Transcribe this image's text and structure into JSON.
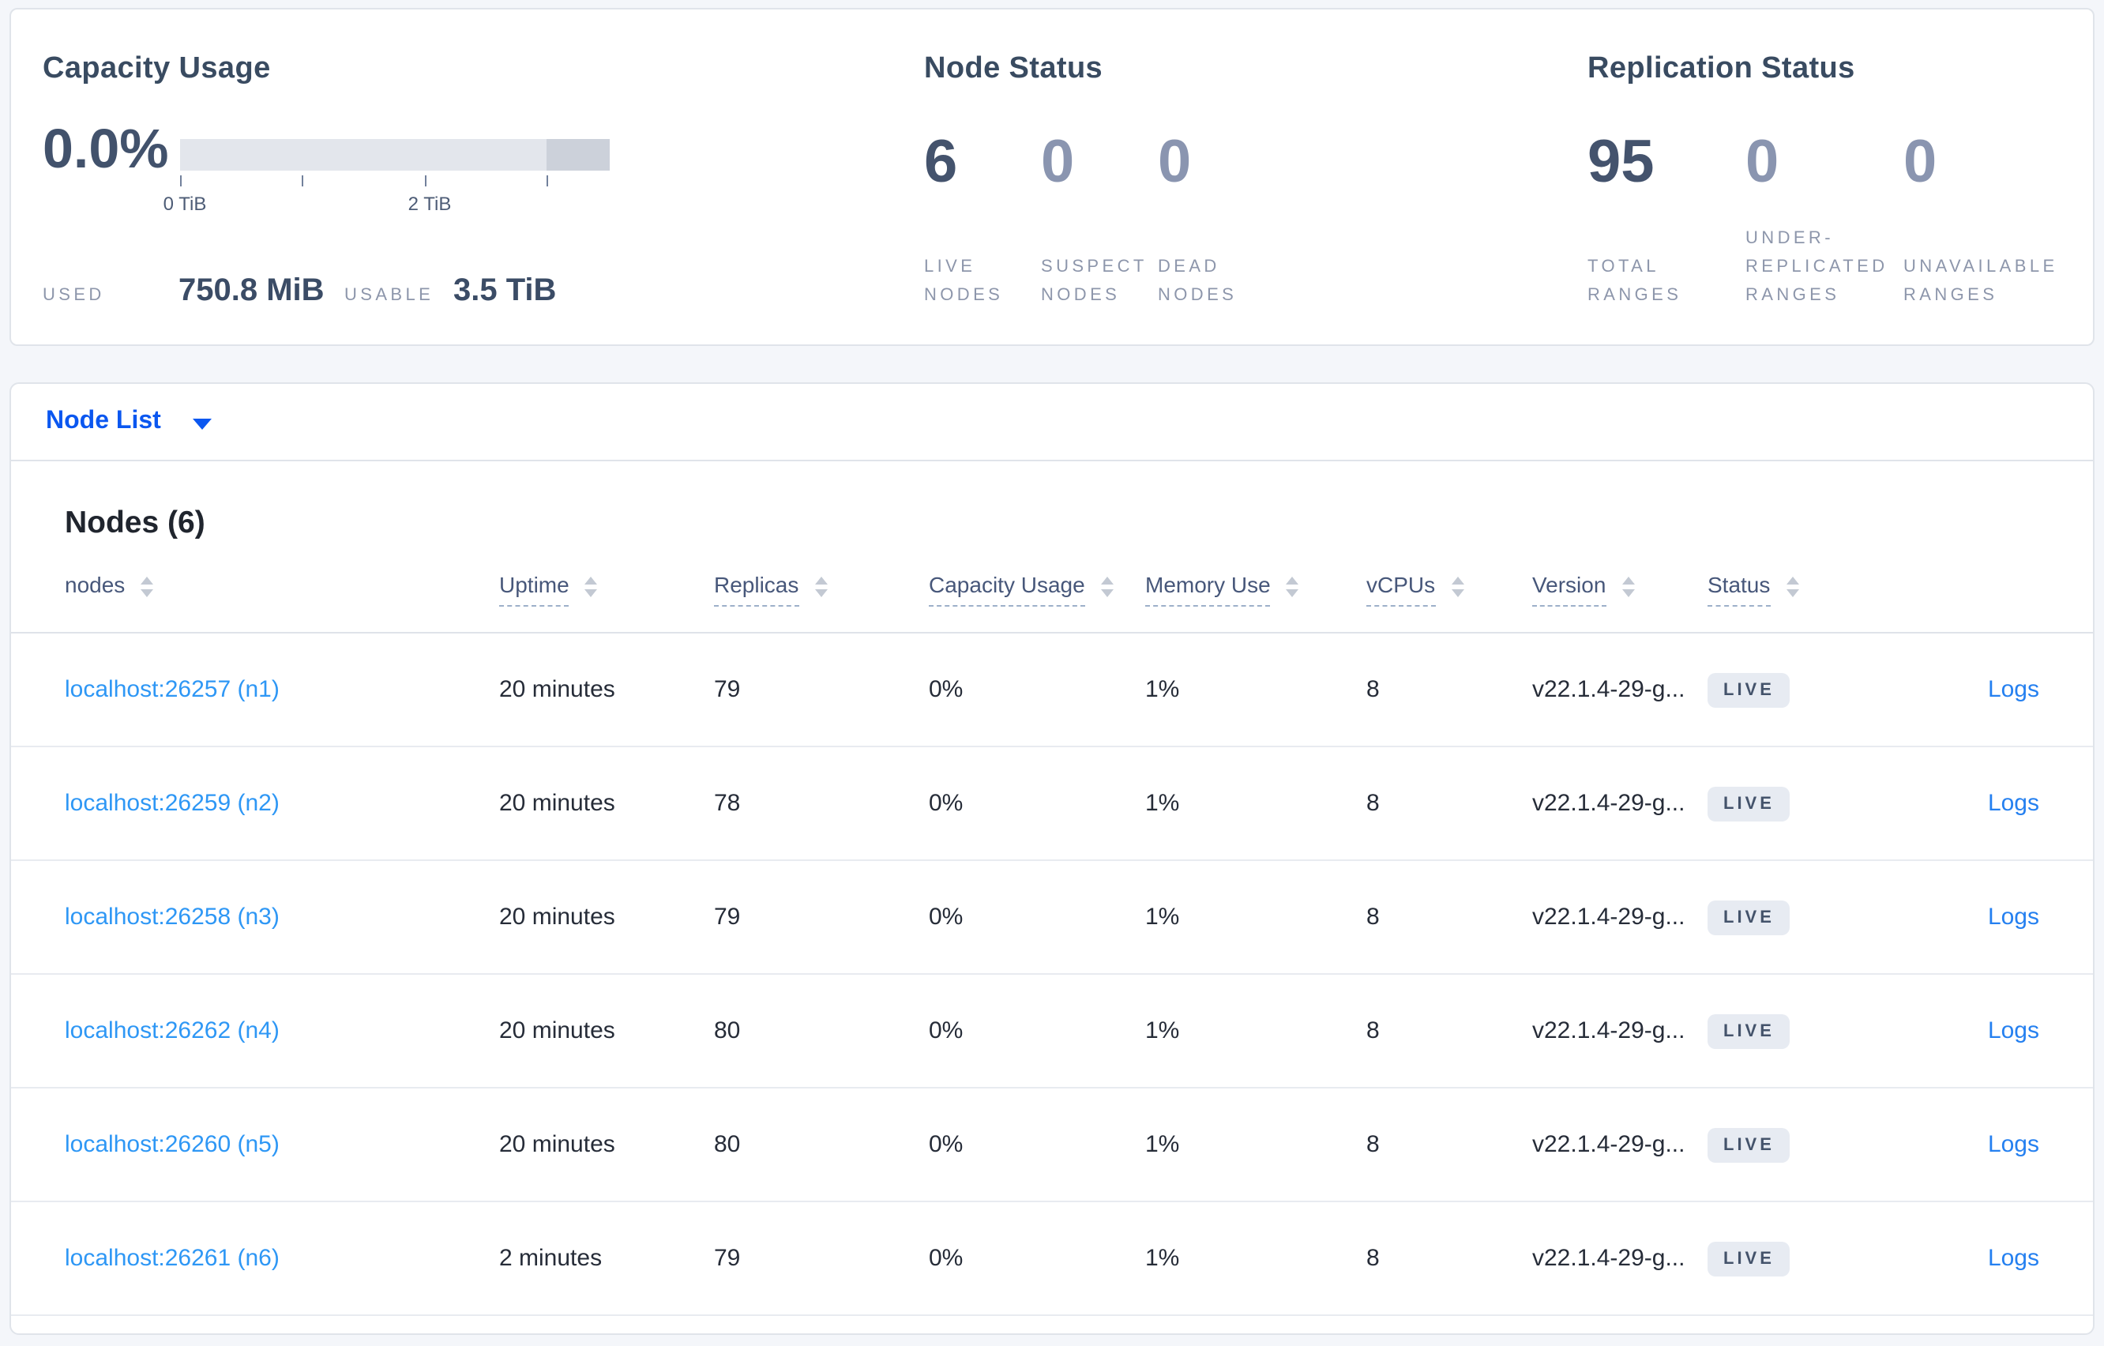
{
  "colors": {
    "page_background": "#f4f6fa",
    "accent_blue": "#0b57f0",
    "node_link_blue": "#2e97f5",
    "logs_link_blue": "#2580f0",
    "dark_slate": "#42526c",
    "muted_slate": "#8d96ab",
    "badge_background": "#e7ebf2",
    "bar_light": "#e3e6ec",
    "bar_dark": "#ccd1da"
  },
  "summary": {
    "capacity": {
      "title": "Capacity Usage",
      "percent_used": "0.0%",
      "axis_ticks": [
        {
          "label": "0 TiB"
        },
        {
          "label": ""
        },
        {
          "label": "2 TiB"
        },
        {
          "label": ""
        }
      ],
      "used_label": "USED",
      "used_value": "750.8 MiB",
      "usable_label": "USABLE",
      "usable_value": "3.5 TiB"
    },
    "node_status": {
      "title": "Node Status",
      "stats": [
        {
          "value": "6",
          "label": "LIVE NODES"
        },
        {
          "value": "0",
          "label": "SUSPECT NODES"
        },
        {
          "value": "0",
          "label": "DEAD NODES"
        }
      ]
    },
    "replication_status": {
      "title": "Replication Status",
      "stats": [
        {
          "value": "95",
          "label": "TOTAL RANGES"
        },
        {
          "value": "0",
          "label": "UNDER-REPLICATED RANGES"
        },
        {
          "value": "0",
          "label": "UNAVAILABLE RANGES"
        }
      ]
    }
  },
  "view_selector": {
    "selected": "Node List",
    "caret_icon": "caret-down"
  },
  "nodes_table": {
    "title": "Nodes (6)",
    "columns": [
      "nodes",
      "Uptime",
      "Replicas",
      "Capacity Usage",
      "Memory Use",
      "vCPUs",
      "Version",
      "Status"
    ],
    "logs_label": "Logs",
    "rows": [
      {
        "node": "localhost:26257 (n1)",
        "uptime": "20 minutes",
        "replicas": "79",
        "capacity": "0%",
        "memory": "1%",
        "vcpus": "8",
        "version": "v22.1.4-29-g...",
        "status": "LIVE"
      },
      {
        "node": "localhost:26259 (n2)",
        "uptime": "20 minutes",
        "replicas": "78",
        "capacity": "0%",
        "memory": "1%",
        "vcpus": "8",
        "version": "v22.1.4-29-g...",
        "status": "LIVE"
      },
      {
        "node": "localhost:26258 (n3)",
        "uptime": "20 minutes",
        "replicas": "79",
        "capacity": "0%",
        "memory": "1%",
        "vcpus": "8",
        "version": "v22.1.4-29-g...",
        "status": "LIVE"
      },
      {
        "node": "localhost:26262 (n4)",
        "uptime": "20 minutes",
        "replicas": "80",
        "capacity": "0%",
        "memory": "1%",
        "vcpus": "8",
        "version": "v22.1.4-29-g...",
        "status": "LIVE"
      },
      {
        "node": "localhost:26260 (n5)",
        "uptime": "20 minutes",
        "replicas": "80",
        "capacity": "0%",
        "memory": "1%",
        "vcpus": "8",
        "version": "v22.1.4-29-g...",
        "status": "LIVE"
      },
      {
        "node": "localhost:26261 (n6)",
        "uptime": "2 minutes",
        "replicas": "79",
        "capacity": "0%",
        "memory": "1%",
        "vcpus": "8",
        "version": "v22.1.4-29-g...",
        "status": "LIVE"
      }
    ]
  }
}
